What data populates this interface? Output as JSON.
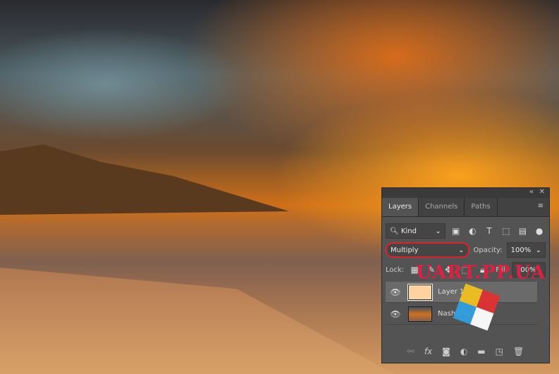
{
  "panel": {
    "tabs": [
      "Layers",
      "Channels",
      "Paths"
    ],
    "filter": {
      "label": "Kind"
    },
    "blend_mode": "Multiply",
    "opacity": {
      "label": "Opacity:",
      "value": "100%"
    },
    "lock": {
      "label": "Lock:"
    },
    "fill": {
      "label": "Fill:",
      "value": "100%"
    },
    "layers": [
      {
        "name": "Layer 1",
        "thumb_color": "#fdd4a0",
        "selected": true
      },
      {
        "name": "Nashville",
        "selected": false
      }
    ]
  },
  "watermark": {
    "text": "UART.PP.UA"
  },
  "highlight_color": "#e0202a"
}
